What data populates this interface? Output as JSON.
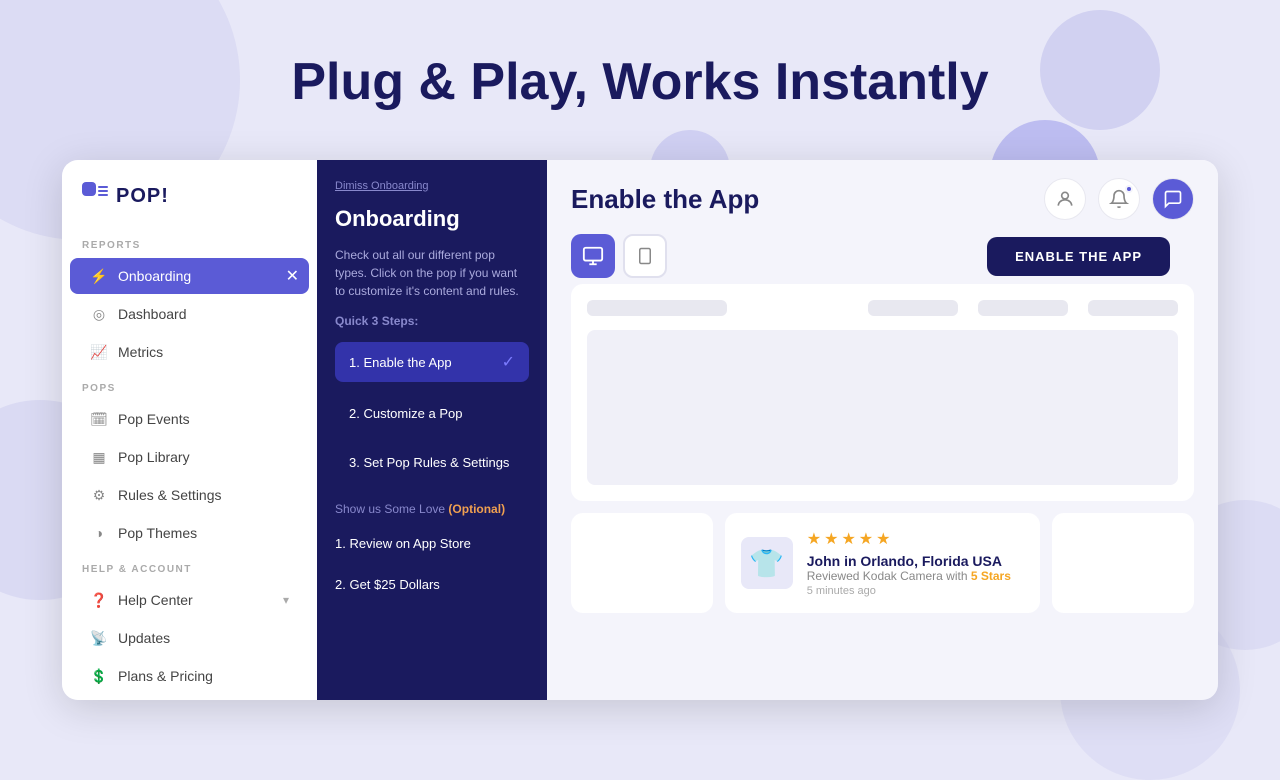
{
  "hero": {
    "title": "Plug & Play, Works Instantly"
  },
  "sidebar": {
    "logo_text": "POP!",
    "sections": [
      {
        "label": "REPORTS",
        "items": [
          {
            "id": "onboarding",
            "label": "Onboarding",
            "icon": "⚡",
            "active": true
          },
          {
            "id": "dashboard",
            "label": "Dashboard",
            "icon": "◎"
          },
          {
            "id": "metrics",
            "label": "Metrics",
            "icon": "📈"
          }
        ]
      },
      {
        "label": "POPS",
        "items": [
          {
            "id": "pop-events",
            "label": "Pop Events",
            "icon": "🗓"
          },
          {
            "id": "pop-library",
            "label": "Pop Library",
            "icon": "▦"
          },
          {
            "id": "rules-settings",
            "label": "Rules & Settings",
            "icon": "≡"
          },
          {
            "id": "pop-themes",
            "label": "Pop Themes",
            "icon": "◑"
          }
        ]
      },
      {
        "label": "HELP & ACCOUNT",
        "items": [
          {
            "id": "help-center",
            "label": "Help Center",
            "icon": "?",
            "has_arrow": true
          },
          {
            "id": "updates",
            "label": "Updates",
            "icon": "📡"
          },
          {
            "id": "plans-pricing",
            "label": "Plans & Pricing",
            "icon": "$"
          }
        ]
      }
    ]
  },
  "onboarding": {
    "dismiss_label": "Dimiss Onboarding",
    "title": "Onboarding",
    "description": "Check out all our different pop types. Click on the pop if you want to customize it's content and rules.",
    "quick_steps_label": "Quick 3 Steps:",
    "steps": [
      {
        "number": "1.",
        "label": "Enable the App",
        "active": true,
        "checked": true
      },
      {
        "number": "2.",
        "label": "Customize a Pop",
        "active": false
      },
      {
        "number": "3.",
        "label": "Set Pop Rules & Settings",
        "active": false
      }
    ],
    "love_label": "Show us Some Love",
    "optional_label": "(Optional)",
    "love_steps": [
      {
        "number": "1.",
        "label": "Review on App Store"
      },
      {
        "number": "2.",
        "label": "Get $25 Dollars"
      }
    ]
  },
  "main": {
    "title": "Enable the App",
    "enable_btn_label": "ENABLE THE APP",
    "device_toggle": [
      {
        "id": "desktop",
        "icon": "🖥",
        "selected": true
      },
      {
        "id": "mobile",
        "icon": "📱",
        "selected": false
      }
    ]
  },
  "review": {
    "name": "John in Orlando, Florida USA",
    "product": "Reviewed Kodak Camera with",
    "stars_label": "5 Stars",
    "time": "5 minutes ago",
    "stars": 5
  },
  "colors": {
    "brand_purple": "#5b5bd6",
    "dark_navy": "#1a1a5e",
    "bg_light": "#e8e8f8"
  }
}
